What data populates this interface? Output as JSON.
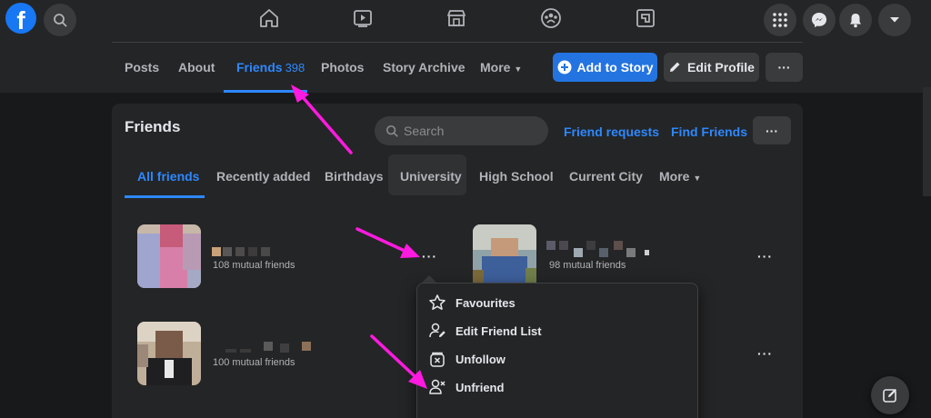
{
  "topbar": {
    "logo": "f",
    "icons": [
      "search-icon",
      "home-icon",
      "watch-icon",
      "marketplace-icon",
      "groups-icon",
      "gaming-icon",
      "menu-grid-icon",
      "messenger-icon",
      "notifications-icon",
      "account-caret-icon"
    ]
  },
  "profile_tabs": {
    "posts": "Posts",
    "about": "About",
    "friends": "Friends",
    "friends_count": "398",
    "photos": "Photos",
    "story_archive": "Story Archive",
    "more": "More",
    "add_story": "Add to Story",
    "edit_profile": "Edit Profile",
    "more_options": "···"
  },
  "friends": {
    "title": "Friends",
    "search_placeholder": "Search",
    "friend_requests": "Friend requests",
    "find_friends": "Find Friends",
    "options": "···",
    "tabs": {
      "all": "All friends",
      "recent": "Recently added",
      "birthdays": "Birthdays",
      "university": "University",
      "high_school": "High School",
      "current_city": "Current City",
      "more": "More"
    },
    "list": [
      {
        "mutual": "108 mutual friends"
      },
      {
        "mutual": "98 mutual friends"
      },
      {
        "mutual": "100 mutual friends"
      }
    ],
    "row_menu": "···"
  },
  "menu": {
    "favourites": "Favourites",
    "edit_friend_list": "Edit Friend List",
    "unfollow": "Unfollow",
    "unfriend": "Unfriend"
  },
  "colors": {
    "background": "#18191a",
    "surface": "#242526",
    "accent": "#2d88ff",
    "primary_button": "#2374e1",
    "annotation_arrow": "#ff1ae0"
  }
}
